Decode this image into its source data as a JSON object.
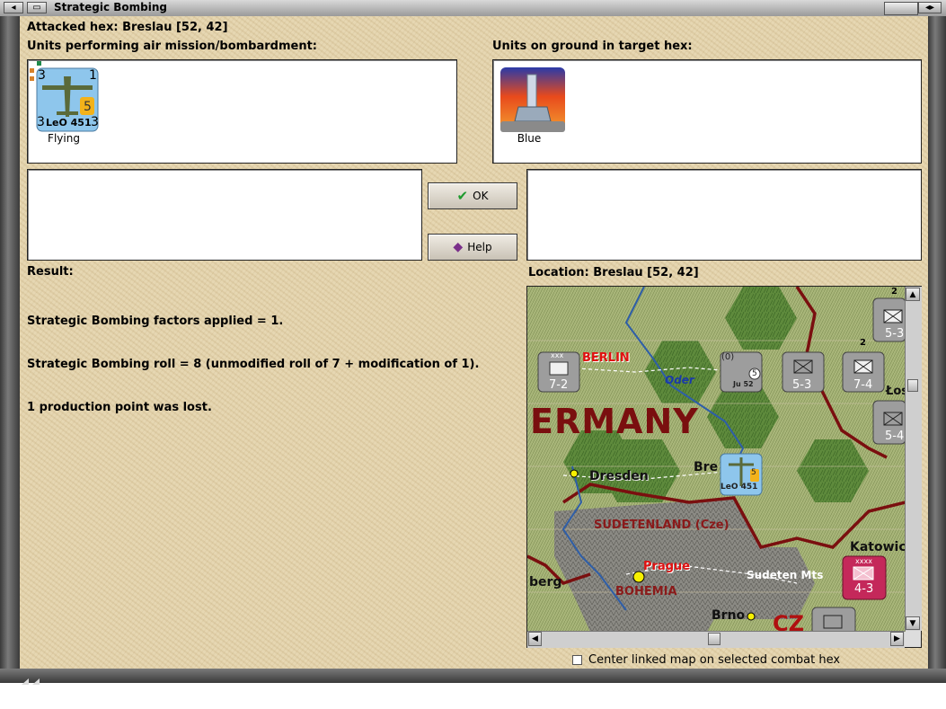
{
  "window": {
    "title": "Strategic Bombing"
  },
  "header": {
    "attacked_hex": "Attacked hex: Breslau  [52, 42]"
  },
  "air_panel": {
    "label": "Units performing air mission/bombardment:",
    "unit": {
      "name": "LeO 451",
      "left_value": "3",
      "right_value": "3",
      "top_left": "3",
      "top_right": "1",
      "badge": "5",
      "status": "Flying"
    }
  },
  "ground_panel": {
    "label": "Units on ground in target hex:",
    "unit": {
      "icon": "anti-aircraft-gun-icon",
      "status": "Blue"
    }
  },
  "buttons": {
    "ok": "OK",
    "help": "Help"
  },
  "result": {
    "label": "Result:",
    "lines": [
      "Strategic Bombing factors applied = 1.",
      "Strategic Bombing roll = 8 (unmodified roll of 7 + modification of 1).",
      "1 production point was lost."
    ]
  },
  "location": {
    "label": "Location:  Breslau  [52, 42]"
  },
  "map": {
    "labels": {
      "berlin": "BERLIN",
      "oder": "Oder",
      "germany": "ERMANY",
      "dresden": "Dresden",
      "breslau": "Bre",
      "sudetenland": "SUDETENLAND (Cze)",
      "prague": "Prague",
      "bohemia": "BOHEMIA",
      "sudeten_mts": "Sudeten Mts",
      "berg": "berg",
      "brno": "Brno",
      "katowice": "Katowic",
      "czech": "CZ",
      "los": "Łos"
    },
    "counters": {
      "berlin_inf": {
        "value": "7-2",
        "size": "xxx"
      },
      "ju52": {
        "name": "Ju 52",
        "top": "(0)",
        "badge": "5"
      },
      "inf_53": {
        "value": "5-3",
        "size": "xxx"
      },
      "inf_74": {
        "value": "7-4",
        "size": "xxx",
        "stack": "2"
      },
      "edge_53": {
        "value": "5-3",
        "stack": "2"
      },
      "edge_54": {
        "value": "5-4"
      },
      "leo": {
        "name": "LeO 451",
        "left": "3",
        "right": "3",
        "badge": "5"
      },
      "polish_43": {
        "value": "4-3",
        "size": "xxxx"
      },
      "bottom_xxx": {
        "size": "xxx"
      }
    }
  },
  "options": {
    "center_map_label": "Center linked map on selected combat hex",
    "center_map_checked": false
  },
  "colors": {
    "dialog_bg": "#e4d3ab",
    "air_unit_bg": "#8ec6ec",
    "german_counter": "#9d9d9d",
    "polish_counter": "#c4285a",
    "map_border": "#7a0f0f"
  }
}
